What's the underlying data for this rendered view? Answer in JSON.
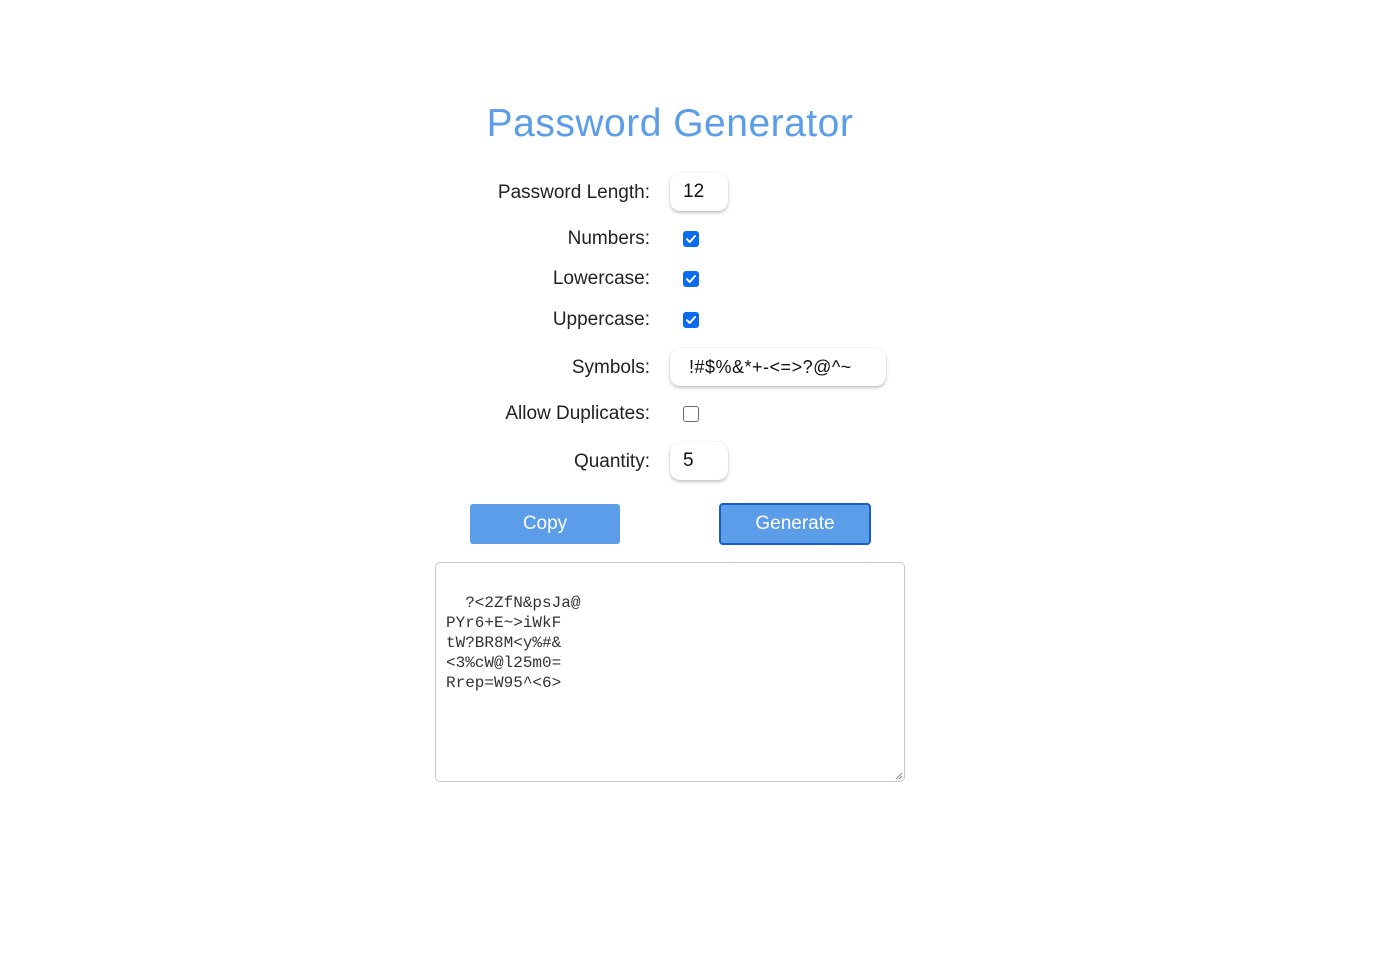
{
  "title": "Password Generator",
  "fields": {
    "length": {
      "label": "Password Length:",
      "value": "12"
    },
    "numbers": {
      "label": "Numbers:",
      "checked": true
    },
    "lowercase": {
      "label": "Lowercase:",
      "checked": true
    },
    "uppercase": {
      "label": "Uppercase:",
      "checked": true
    },
    "symbols": {
      "label": "Symbols:",
      "value": "!#$%&*+-<=>?@^~"
    },
    "duplicates": {
      "label": "Allow Duplicates:",
      "checked": false
    },
    "quantity": {
      "label": "Quantity:",
      "value": "5"
    }
  },
  "buttons": {
    "copy": "Copy",
    "generate": "Generate"
  },
  "output": {
    "passwords": "?<2ZfN&psJa@\nPYr6+E~>iWkF\ntW?BR8M<y%#&\n<3%cW@l25m0=\nRrep=W95^<6>"
  },
  "colors": {
    "accent": "#5b9de8",
    "checkbox": "#0b6cf0",
    "generate_border": "#1a5fc4"
  }
}
